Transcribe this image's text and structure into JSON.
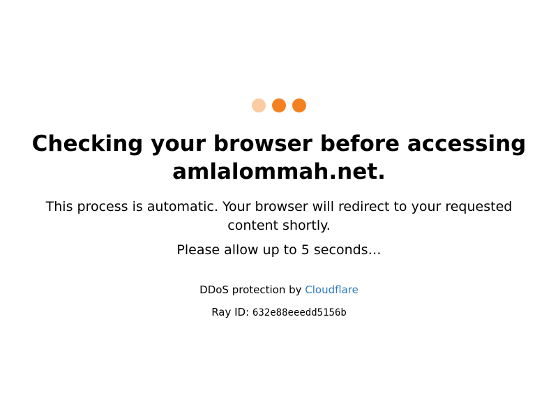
{
  "loader": {
    "dot_colors": [
      "#fbcba2",
      "#f48120",
      "#f48120"
    ]
  },
  "heading": {
    "line1": "Checking your browser before accessing",
    "line2": "amlalommah.net."
  },
  "process_text": "This process is automatic. Your browser will redirect to your requested content shortly.",
  "allow_text": "Please allow up to 5 seconds…",
  "ddos": {
    "prefix": "DDoS protection by ",
    "link_label": "Cloudflare",
    "link_color": "#2f7bbf"
  },
  "ray": {
    "label": "Ray ID: ",
    "id": "632e88eeedd5156b"
  }
}
